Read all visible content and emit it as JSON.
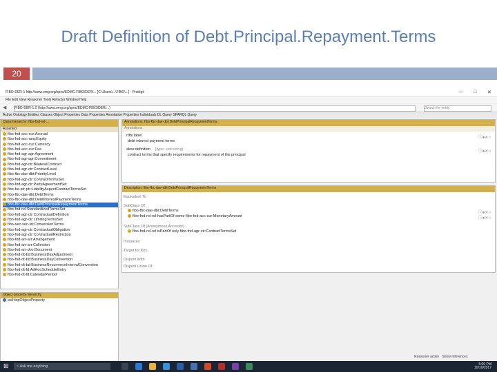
{
  "slide": {
    "title": "Draft Definition of Debt.Principal.Repayment.Terms",
    "number": "20"
  },
  "window": {
    "title": "FIBO-DER-1 http://www.omg.org/spec/EDMC-FIBO/DER/... [C:\\Users\\...\\FIBO\\...] - Protégé",
    "menu": "File  Edit  View  Reasoner  Tools  Refactor  Window  Help",
    "address": "FIBO-DER-1.0  (http://www.omg.org/spec/EDMC-FIBO/DER/...)",
    "search_placeholder": "Search for entity",
    "tabs": "Active Ontology  Entities  Classes  Object Properties  Data Properties  Annotation Properties  Individuals  DL Query  SPARQL Query"
  },
  "left_panel": {
    "header": "Class hierarchy:  fibo-fnd-rel-...",
    "subheader": "Asserted",
    "tree": [
      "fibo-fnd-acc-cur:Accrual",
      "fibo-fnd-acc-aeq:Equity",
      "fibo-fnd-acc-cur:Currency",
      "fibo-fnd-acc-cur:Fee",
      "fibo-fnd-agr-agr:Agreement",
      "fibo-fnd-agr-agr:Commitment",
      "fibo-fnd-agr-ctr:BilateralContract",
      "fibo-fnd-agr-ctr:ContractLevel",
      "fibo-fbc-dae-dbt:PriorityLevel",
      "fibo-fnd-agr-ctr:ContractTermsSet",
      "fibo-fnd-agr-ctr:PartyAgreementSet",
      "fibo-be-ptr-ptr:LiabilityAspectContractTermsSet",
      "fibo-fbc-dae-dbt:DebtTerms",
      "fibo-fbc-dae-dbt:DebtInterestPaymentTerms",
      "fibo-fbc-dae-dbt:DebtPrincipalRepaymentTerms",
      "fibo-fnd-rel:StandardizedTermsSet",
      "fibo-fnd-agr-ctr:ContractualDefinition",
      "fibo-fnd-agr-ctr:LimitingTermsSet",
      "fibo-sec-sec-ist:ConversionTerms",
      "fibo-fnd-agr-ctr:ContractualObligation",
      "fibo-fnd-agr-ctr:ContractualRestriction",
      "fibo-fnd-arr-arr:Arrangement",
      "fibo-fnd-arr-arr:Collection",
      "fibo-fnd-arr-doc:Document",
      "fibo-fnd-dt-bd:BusinessDayAdjustment",
      "fibo-fnd-dt-bd:BusinessDayConvention",
      "fibo-fnd-dt-bd:BusinessRecurrenceIntervalConvention",
      "fibo-fnd-dt-fd:AdHocScheduleEntry",
      "fibo-fnd-dt-fd:CalendarPeriod"
    ],
    "selected_index": 14,
    "bottom_header": "Object property hierarchy",
    "bottom_item": "owl:topObjectProperty"
  },
  "annotations_panel": {
    "header": "Annotations: fibo-fbc-dae-dbt:DebtPrincipalRepaymentTerms",
    "section": "Annotations",
    "label_key": "rdfs:label",
    "label_value": "debt interest payment terms",
    "def_key": "skos:definition",
    "def_lang": "[type: xsd:string]",
    "def_value": "contract terms that specify requirements for repayment of the principal"
  },
  "description_panel": {
    "header": "Description: fibo-fbc-dae-dbt:DebtPrincipalRepaymentTerms",
    "equiv": "Equivalent To",
    "subclass": "SubClass Of",
    "sub1": "fibo-fbc-dae-dbt:DebtTerms",
    "sub2": "fibo-fnd-rel-rel:hasPartOf some fibo-fnd-acc-cur:MonetaryAmount",
    "sub_anon": "SubClass Of (Anonymous Ancestor)",
    "sub3": "fibo-fnd-rel-rel:isPartOf only fibo-fnd-agr-ctr:ContractTermsSet",
    "instances": "Instances",
    "target_keys": "Target for Key",
    "disjoint": "Disjoint With",
    "disjoint_union": "Disjoint Union Of"
  },
  "status": {
    "reasoner": "Reasoner active",
    "inferences": "Show Inferences"
  },
  "taskbar": {
    "search": "Ask me anything",
    "time": "5:00 PM",
    "date": "10/10/2017"
  },
  "colors": {
    "title": "#5a7fb0",
    "slide_number_bg": "#c0504d",
    "slide_bar": "#9aaecd",
    "panel_header": "#d4b04a",
    "selection": "#2c6fc7",
    "taskbar": "#1c2533"
  }
}
